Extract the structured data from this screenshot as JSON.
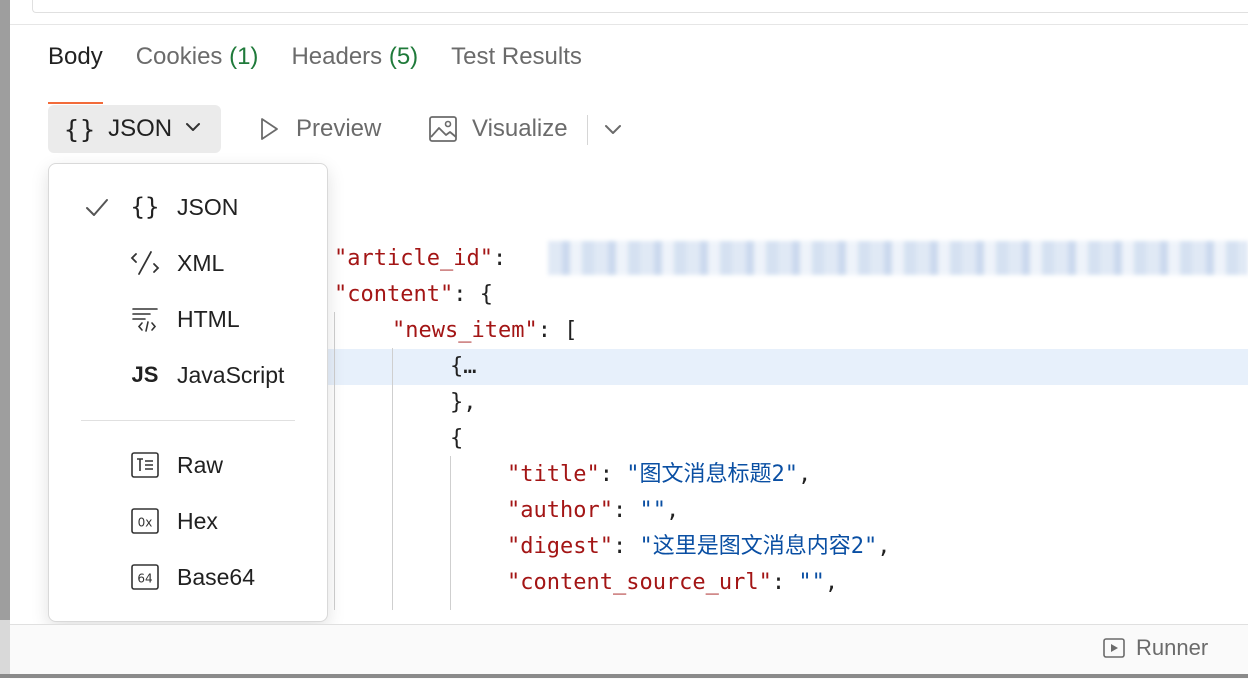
{
  "response_tabs": [
    {
      "label": "Body",
      "count": ""
    },
    {
      "label": "Cookies",
      "count": "(1)"
    },
    {
      "label": "Headers",
      "count": "(5)"
    },
    {
      "label": "Test Results",
      "count": ""
    }
  ],
  "toolbar": {
    "format_label": "JSON",
    "preview_label": "Preview",
    "visualize_label": "Visualize"
  },
  "format_menu": {
    "options": [
      {
        "label": "JSON",
        "icon": "braces-icon",
        "selected": true
      },
      {
        "label": "XML",
        "icon": "xml-icon",
        "selected": false
      },
      {
        "label": "HTML",
        "icon": "html-icon",
        "selected": false
      },
      {
        "label": "JavaScript",
        "icon": "js-icon",
        "selected": false
      },
      {
        "label": "Raw",
        "icon": "raw-icon",
        "selected": false
      },
      {
        "label": "Hex",
        "icon": "hex-icon",
        "selected": false
      },
      {
        "label": "Base64",
        "icon": "base64-icon",
        "selected": false
      }
    ]
  },
  "code": {
    "k_article_id": "\"article_id\"",
    "k_content": "\"content\"",
    "k_news_item": "\"news_item\"",
    "collapsed": "{…",
    "close_obj": "},",
    "open_obj": "{",
    "k_title": "\"title\"",
    "v_title": "\"图文消息标题2\"",
    "k_author": "\"author\"",
    "v_author": "\"\"",
    "k_digest": "\"digest\"",
    "v_digest": "\"这里是图文消息内容2\"",
    "k_source_url": "\"content_source_url\"",
    "v_source_url": "\"\""
  },
  "footer": {
    "runner_label": "Runner"
  },
  "colors": {
    "active_tab_underline": "#f26b3a",
    "count_green": "#1f7a3a",
    "json_key": "#a31515",
    "json_string": "#0a4fa3",
    "line_highlight": "#e7f0fb"
  }
}
